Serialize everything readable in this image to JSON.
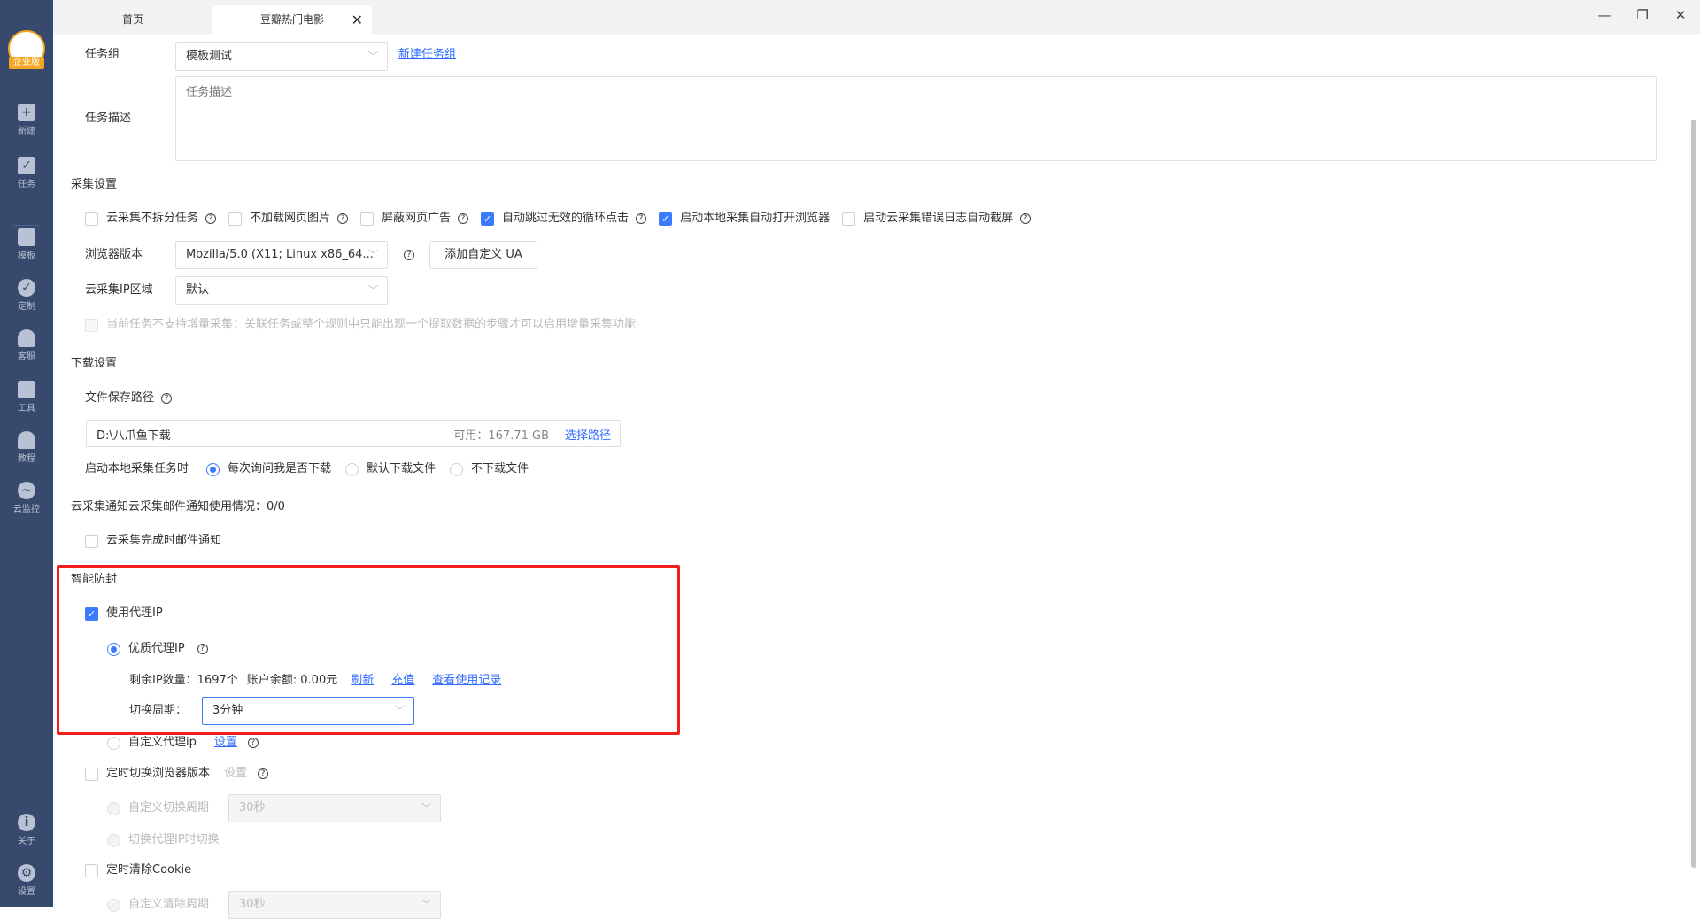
{
  "sidebar": {
    "logo_badge": "企业版",
    "items": [
      {
        "label": "新建",
        "icon": "plus-icon"
      },
      {
        "label": "任务",
        "icon": "bookmark-icon"
      },
      {
        "label": "模板",
        "icon": "template-icon"
      },
      {
        "label": "定制",
        "icon": "heart-check-icon"
      },
      {
        "label": "客服",
        "icon": "headset-icon"
      },
      {
        "label": "工具",
        "icon": "toolbox-icon"
      },
      {
        "label": "教程",
        "icon": "graduation-cap-icon"
      },
      {
        "label": "云监控",
        "icon": "cloud-monitor-icon"
      }
    ],
    "bottom": [
      {
        "label": "关于",
        "icon": "info-icon"
      },
      {
        "label": "设置",
        "icon": "gear-icon"
      }
    ]
  },
  "tabs": [
    {
      "label": "首页"
    },
    {
      "label": "豆瓣热门电影"
    }
  ],
  "form": {
    "task_group_label": "任务组",
    "task_group_value": "模板测试",
    "new_task_group": "新建任务组",
    "task_desc_label": "任务描述",
    "task_desc_placeholder": "任务描述",
    "collect_settings": "采集设置",
    "options": [
      {
        "label": "云采集不拆分任务",
        "checked": false
      },
      {
        "label": "不加载网页图片",
        "checked": false
      },
      {
        "label": "屏蔽网页广告",
        "checked": false
      },
      {
        "label": "自动跳过无效的循环点击",
        "checked": true
      },
      {
        "label": "启动本地采集自动打开浏览器",
        "checked": true
      },
      {
        "label": "启动云采集错误日志自动截屏",
        "checked": false
      }
    ],
    "browser_label": "浏览器版本",
    "browser_value": "Mozilla/5.0 (X11; Linux x86_64...",
    "add_ua": "添加自定义 UA",
    "ip_region_label": "云采集IP区域",
    "ip_region_value": "默认",
    "incremental": "当前任务不支持增量采集：关联任务或整个规则中只能出现一个提取数据的步骤才可以启用增量采集功能",
    "download_settings": "下载设置",
    "save_path_label": "文件保存路径",
    "save_path": "D:\\八爪鱼下载",
    "available": "可用：167.71 GB",
    "choose_path": "选择路径",
    "on_start_label": "启动本地采集任务时",
    "on_start_options": [
      "每次询问我是否下载",
      "默认下载文件",
      "不下载文件"
    ],
    "email_usage": "云采集通知云采集邮件通知使用情况：0/0",
    "email_notify": "云采集完成时邮件通知",
    "anti_block": "智能防封",
    "use_proxy": "使用代理IP",
    "quality_proxy": "优质代理IP",
    "remaining_ip": "剩余IP数量：1697个",
    "balance": "账户余额: 0.00元",
    "refresh": "刷新",
    "recharge": "充值",
    "usage_log": "查看使用记录",
    "switch_period_label": "切换周期：",
    "switch_period_value": "3分钟",
    "custom_proxy": "自定义代理ip",
    "setting": "设置",
    "timed_browser": "定时切换浏览器版本",
    "custom_switch_period": "自定义切换周期",
    "switch_value": "30秒",
    "switch_on_proxy": "切换代理IP时切换",
    "clear_cookie": "定时清除Cookie",
    "custom_clear_period": "自定义清除周期",
    "clear_value": "30秒"
  },
  "colors": {
    "accent": "#3b7cff",
    "sidebar": "#374a6d",
    "highlight": "#f01e1e"
  }
}
